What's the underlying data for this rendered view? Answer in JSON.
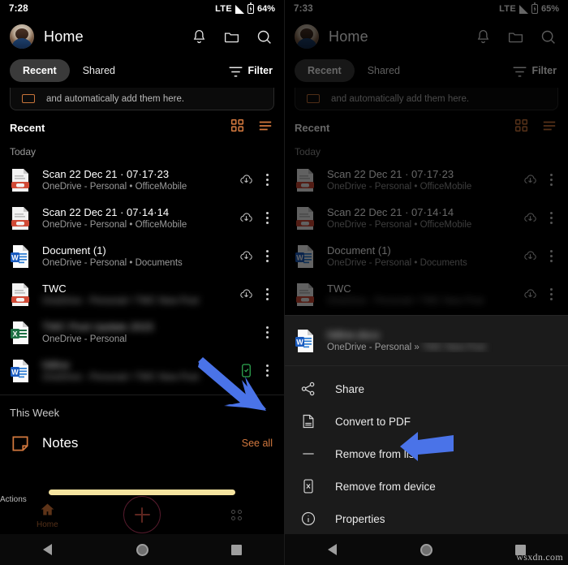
{
  "left": {
    "status": {
      "time": "7:28",
      "network": "LTE",
      "battery_pct": "64%",
      "signal_icon": "signal-bars-icon",
      "battery_icon": "battery-charging-icon"
    },
    "header": {
      "title": "Home",
      "avatar": "user-avatar",
      "icons": [
        "bell-icon",
        "folder-icon",
        "search-icon"
      ]
    },
    "tabs": {
      "items": [
        {
          "label": "Recent",
          "active": true
        },
        {
          "label": "Shared",
          "active": false
        }
      ],
      "filter_label": "Filter",
      "filter_icon": "filter-icon"
    },
    "promo": {
      "text": "and automatically add them here.",
      "icon": "scan-card-icon"
    },
    "section": {
      "title": "Recent",
      "grid_icon": "grid-view-icon",
      "list_icon": "list-view-icon",
      "group_label": "Today"
    },
    "files": [
      {
        "name": "Scan 22 Dec 21 · 07·17·23",
        "sub": "OneDrive - Personal • OfficeMobile",
        "icon": "pdf-file-icon",
        "action": "cloud-download-icon",
        "name_blurred": false,
        "sub_blurred": false
      },
      {
        "name": "Scan 22 Dec 21 · 07·14·14",
        "sub": "OneDrive - Personal • OfficeMobile",
        "icon": "pdf-file-icon",
        "action": "cloud-download-icon",
        "name_blurred": false,
        "sub_blurred": false
      },
      {
        "name": "Document (1)",
        "sub": "OneDrive - Personal • Documents",
        "icon": "word-file-icon",
        "action": "cloud-download-icon",
        "name_blurred": false,
        "sub_blurred": false
      },
      {
        "name": "TWC",
        "sub": "OneDrive - Personal • TWC New Post",
        "icon": "pdf-file-icon",
        "action": "cloud-download-icon",
        "name_blurred": false,
        "sub_blurred": true
      },
      {
        "name": "TWC Post Update 2015",
        "sub": "OneDrive - Personal",
        "icon": "excel-file-icon",
        "action": "none",
        "name_blurred": true,
        "sub_blurred": false
      },
      {
        "name": "hitline",
        "sub": "OneDrive - Personal • TWC New Post",
        "icon": "word-file-icon",
        "action": "on-device-icon",
        "name_blurred": true,
        "sub_blurred": true
      }
    ],
    "week": {
      "label": "This Week",
      "notes_title": "Notes",
      "notes_icon": "sticky-note-icon",
      "see_all": "See all"
    },
    "bottomnav": {
      "home_label": "Home",
      "home_icon": "home-icon",
      "add_icon": "plus-icon",
      "actions_label": "Actions",
      "actions_icon": "four-dots-icon"
    },
    "sysnav": {
      "back": "back-triangle-icon",
      "home": "home-circle-icon",
      "recents": "recents-square-icon"
    }
  },
  "right": {
    "status": {
      "time": "7:33",
      "network": "LTE",
      "battery_pct": "65%",
      "signal_icon": "signal-bars-icon",
      "battery_icon": "battery-charging-icon"
    },
    "header": {
      "title": "Home",
      "avatar": "user-avatar",
      "icons": [
        "bell-icon",
        "folder-icon",
        "search-icon"
      ]
    },
    "tabs": {
      "items": [
        {
          "label": "Recent",
          "active": true
        },
        {
          "label": "Shared",
          "active": false
        }
      ],
      "filter_label": "Filter",
      "filter_icon": "filter-icon"
    },
    "promo": {
      "text": "and automatically add them here.",
      "icon": "scan-card-icon"
    },
    "section": {
      "title": "Recent",
      "grid_icon": "grid-view-icon",
      "list_icon": "list-view-icon",
      "group_label": "Today"
    },
    "files": [
      {
        "name": "Scan 22 Dec 21 · 07·17·23",
        "sub": "OneDrive - Personal • OfficeMobile",
        "icon": "pdf-file-icon",
        "action": "cloud-download-icon",
        "name_blurred": false,
        "sub_blurred": false
      },
      {
        "name": "Scan 22 Dec 21 · 07·14·14",
        "sub": "OneDrive - Personal • OfficeMobile",
        "icon": "pdf-file-icon",
        "action": "cloud-download-icon",
        "name_blurred": false,
        "sub_blurred": false
      },
      {
        "name": "Document (1)",
        "sub": "OneDrive - Personal • Documents",
        "icon": "word-file-icon",
        "action": "cloud-download-icon",
        "name_blurred": false,
        "sub_blurred": false
      },
      {
        "name": "TWC",
        "sub": "OneDrive - Personal • TWC New Post",
        "icon": "pdf-file-icon",
        "action": "cloud-download-icon",
        "name_blurred": false,
        "sub_blurred": true
      }
    ],
    "sheet": {
      "file": {
        "name": "hitline.docx",
        "sub_prefix": "OneDrive - Personal » ",
        "sub_blurred_part": "TWC New Post",
        "icon": "word-file-icon"
      },
      "menu": [
        {
          "label": "Share",
          "icon": "share-icon"
        },
        {
          "label": "Convert to PDF",
          "icon": "convert-pdf-icon"
        },
        {
          "label": "Remove from list",
          "icon": "minus-icon"
        },
        {
          "label": "Remove from device",
          "icon": "remove-device-icon"
        },
        {
          "label": "Properties",
          "icon": "info-icon"
        }
      ]
    },
    "sysnav": {
      "back": "back-triangle-icon",
      "home": "home-circle-icon",
      "recents": "recents-square-icon"
    },
    "watermark": "wsxdn.com"
  },
  "annotations": {
    "arrow_left": "blue-arrow-pointing-to-on-device-icon",
    "arrow_right": "blue-arrow-pointing-to-convert-to-pdf"
  },
  "colors": {
    "accent_orange": "#d2783e",
    "word_blue": "#1a5bbf",
    "excel_green": "#1d7044",
    "pdf_red": "#d04a36",
    "arrow_blue": "#4a73e8",
    "sheet_bg": "#1b1b1b",
    "on_device_green": "#2faa52"
  }
}
